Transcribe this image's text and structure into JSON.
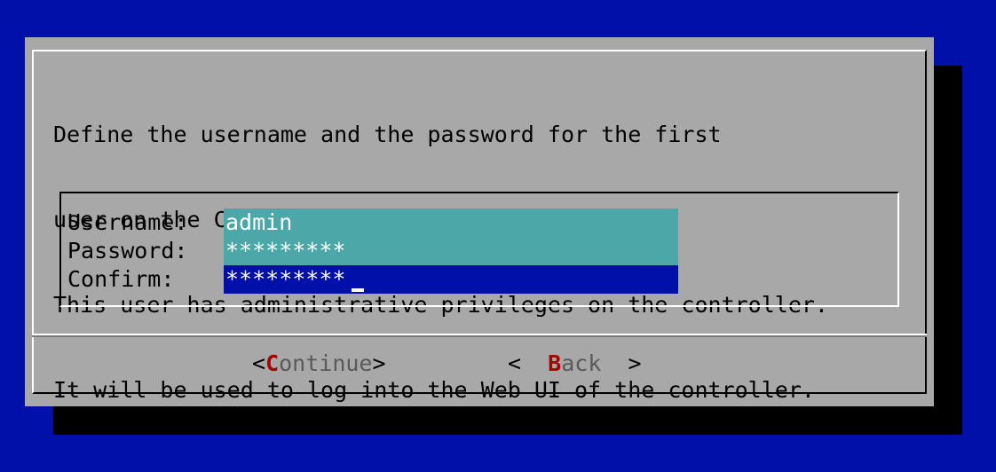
{
  "dialog": {
    "message_lines": [
      "Define the username and the password for the first",
      "user on the CML^2 controller.",
      "This user has administrative privileges on the controller.",
      "It will be used to log into the Web UI of the controller."
    ],
    "form": {
      "username": {
        "label": "Username:",
        "value": "admin"
      },
      "password": {
        "label": "Password:",
        "value": "*********"
      },
      "confirm": {
        "label": "Confirm:",
        "value": "*********"
      }
    },
    "buttons": {
      "continue": {
        "open": "<",
        "hotkey": "C",
        "rest": "ontinue",
        "close": ">"
      },
      "back": {
        "open": "<  ",
        "hotkey": "B",
        "rest": "ack",
        "close": "  >"
      }
    }
  },
  "colors": {
    "screen_background": "#0010a8",
    "dialog_background": "#a8a8a8",
    "field_background": "#4ca8a8",
    "active_field_background": "#0010a8",
    "hotkey": "#a80000"
  }
}
